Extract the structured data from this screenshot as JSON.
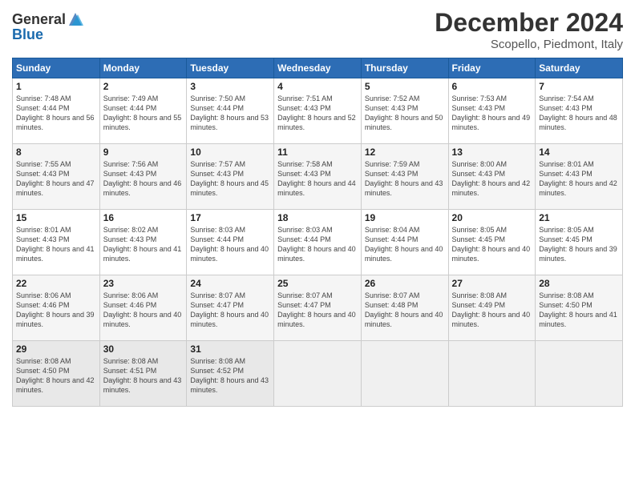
{
  "header": {
    "logo_general": "General",
    "logo_blue": "Blue",
    "month_title": "December 2024",
    "location": "Scopello, Piedmont, Italy"
  },
  "weekdays": [
    "Sunday",
    "Monday",
    "Tuesday",
    "Wednesday",
    "Thursday",
    "Friday",
    "Saturday"
  ],
  "weeks": [
    [
      {
        "day": "1",
        "sunrise": "7:48 AM",
        "sunset": "4:44 PM",
        "daylight": "8 hours and 56 minutes."
      },
      {
        "day": "2",
        "sunrise": "7:49 AM",
        "sunset": "4:44 PM",
        "daylight": "8 hours and 55 minutes."
      },
      {
        "day": "3",
        "sunrise": "7:50 AM",
        "sunset": "4:44 PM",
        "daylight": "8 hours and 53 minutes."
      },
      {
        "day": "4",
        "sunrise": "7:51 AM",
        "sunset": "4:43 PM",
        "daylight": "8 hours and 52 minutes."
      },
      {
        "day": "5",
        "sunrise": "7:52 AM",
        "sunset": "4:43 PM",
        "daylight": "8 hours and 50 minutes."
      },
      {
        "day": "6",
        "sunrise": "7:53 AM",
        "sunset": "4:43 PM",
        "daylight": "8 hours and 49 minutes."
      },
      {
        "day": "7",
        "sunrise": "7:54 AM",
        "sunset": "4:43 PM",
        "daylight": "8 hours and 48 minutes."
      }
    ],
    [
      {
        "day": "8",
        "sunrise": "7:55 AM",
        "sunset": "4:43 PM",
        "daylight": "8 hours and 47 minutes."
      },
      {
        "day": "9",
        "sunrise": "7:56 AM",
        "sunset": "4:43 PM",
        "daylight": "8 hours and 46 minutes."
      },
      {
        "day": "10",
        "sunrise": "7:57 AM",
        "sunset": "4:43 PM",
        "daylight": "8 hours and 45 minutes."
      },
      {
        "day": "11",
        "sunrise": "7:58 AM",
        "sunset": "4:43 PM",
        "daylight": "8 hours and 44 minutes."
      },
      {
        "day": "12",
        "sunrise": "7:59 AM",
        "sunset": "4:43 PM",
        "daylight": "8 hours and 43 minutes."
      },
      {
        "day": "13",
        "sunrise": "8:00 AM",
        "sunset": "4:43 PM",
        "daylight": "8 hours and 42 minutes."
      },
      {
        "day": "14",
        "sunrise": "8:01 AM",
        "sunset": "4:43 PM",
        "daylight": "8 hours and 42 minutes."
      }
    ],
    [
      {
        "day": "15",
        "sunrise": "8:01 AM",
        "sunset": "4:43 PM",
        "daylight": "8 hours and 41 minutes."
      },
      {
        "day": "16",
        "sunrise": "8:02 AM",
        "sunset": "4:43 PM",
        "daylight": "8 hours and 41 minutes."
      },
      {
        "day": "17",
        "sunrise": "8:03 AM",
        "sunset": "4:44 PM",
        "daylight": "8 hours and 40 minutes."
      },
      {
        "day": "18",
        "sunrise": "8:03 AM",
        "sunset": "4:44 PM",
        "daylight": "8 hours and 40 minutes."
      },
      {
        "day": "19",
        "sunrise": "8:04 AM",
        "sunset": "4:44 PM",
        "daylight": "8 hours and 40 minutes."
      },
      {
        "day": "20",
        "sunrise": "8:05 AM",
        "sunset": "4:45 PM",
        "daylight": "8 hours and 40 minutes."
      },
      {
        "day": "21",
        "sunrise": "8:05 AM",
        "sunset": "4:45 PM",
        "daylight": "8 hours and 39 minutes."
      }
    ],
    [
      {
        "day": "22",
        "sunrise": "8:06 AM",
        "sunset": "4:46 PM",
        "daylight": "8 hours and 39 minutes."
      },
      {
        "day": "23",
        "sunrise": "8:06 AM",
        "sunset": "4:46 PM",
        "daylight": "8 hours and 40 minutes."
      },
      {
        "day": "24",
        "sunrise": "8:07 AM",
        "sunset": "4:47 PM",
        "daylight": "8 hours and 40 minutes."
      },
      {
        "day": "25",
        "sunrise": "8:07 AM",
        "sunset": "4:47 PM",
        "daylight": "8 hours and 40 minutes."
      },
      {
        "day": "26",
        "sunrise": "8:07 AM",
        "sunset": "4:48 PM",
        "daylight": "8 hours and 40 minutes."
      },
      {
        "day": "27",
        "sunrise": "8:08 AM",
        "sunset": "4:49 PM",
        "daylight": "8 hours and 40 minutes."
      },
      {
        "day": "28",
        "sunrise": "8:08 AM",
        "sunset": "4:50 PM",
        "daylight": "8 hours and 41 minutes."
      }
    ],
    [
      {
        "day": "29",
        "sunrise": "8:08 AM",
        "sunset": "4:50 PM",
        "daylight": "8 hours and 42 minutes."
      },
      {
        "day": "30",
        "sunrise": "8:08 AM",
        "sunset": "4:51 PM",
        "daylight": "8 hours and 43 minutes."
      },
      {
        "day": "31",
        "sunrise": "8:08 AM",
        "sunset": "4:52 PM",
        "daylight": "8 hours and 43 minutes."
      },
      null,
      null,
      null,
      null
    ]
  ],
  "labels": {
    "sunrise": "Sunrise:",
    "sunset": "Sunset:",
    "daylight": "Daylight:"
  }
}
